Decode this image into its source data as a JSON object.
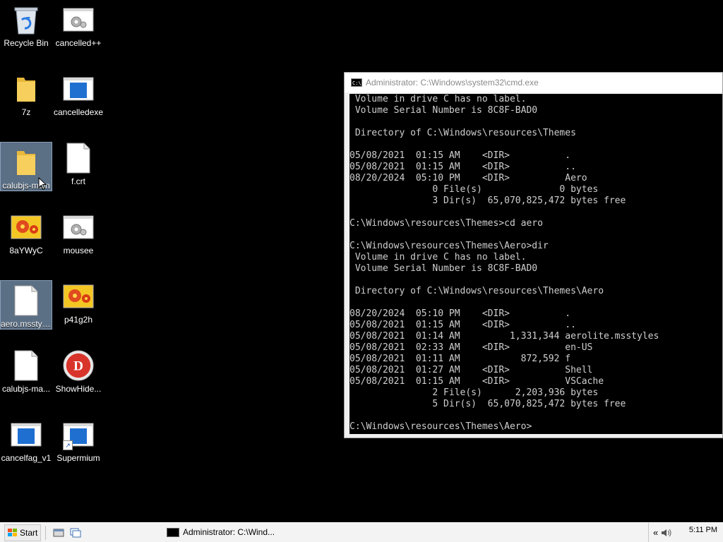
{
  "desktop": {
    "icons": [
      {
        "label": "Recycle Bin",
        "icon": "recycle-bin-icon"
      },
      {
        "label": "cancelled++",
        "icon": "application-gear-icon"
      },
      {
        "label": "7z",
        "icon": "folder-icon"
      },
      {
        "label": "cancelledexe",
        "icon": "application-window-icon"
      },
      {
        "label": "calubjs-main",
        "icon": "folder-icon"
      },
      {
        "label": "f.crt",
        "icon": "blank-file-icon"
      },
      {
        "label": "8aYWyC",
        "icon": "flower-image-icon"
      },
      {
        "label": "mousee",
        "icon": "application-gear-icon"
      },
      {
        "label": "aero.msstyles",
        "icon": "blank-file-icon"
      },
      {
        "label": "p41g2h",
        "icon": "flower-image-icon"
      },
      {
        "label": "calubjs-ma...",
        "icon": "blank-file-icon"
      },
      {
        "label": "ShowHide...",
        "icon": "red-d-circle-icon"
      },
      {
        "label": "cancelfag_v1",
        "icon": "application-window-icon"
      },
      {
        "label": "Supermium",
        "icon": "application-window-shortcut-icon"
      }
    ]
  },
  "cmd_window": {
    "title": "Administrator: C:\\Windows\\system32\\cmd.exe",
    "lines": [
      " Volume in drive C has no label.",
      " Volume Serial Number is 8C8F-BAD0",
      "",
      " Directory of C:\\Windows\\resources\\Themes",
      "",
      "05/08/2021  01:15 AM    <DIR>          .",
      "05/08/2021  01:15 AM    <DIR>          ..",
      "08/20/2024  05:10 PM    <DIR>          Aero",
      "               0 File(s)              0 bytes",
      "               3 Dir(s)  65,070,825,472 bytes free",
      "",
      "C:\\Windows\\resources\\Themes>cd aero",
      "",
      "C:\\Windows\\resources\\Themes\\Aero>dir",
      " Volume in drive C has no label.",
      " Volume Serial Number is 8C8F-BAD0",
      "",
      " Directory of C:\\Windows\\resources\\Themes\\Aero",
      "",
      "08/20/2024  05:10 PM    <DIR>          .",
      "05/08/2021  01:15 AM    <DIR>          ..",
      "05/08/2021  01:14 AM         1,331,344 aerolite.msstyles",
      "05/08/2021  02:33 AM    <DIR>          en-US",
      "05/08/2021  01:11 AM           872,592 f",
      "05/08/2021  01:27 AM    <DIR>          Shell",
      "05/08/2021  01:15 AM    <DIR>          VSCache",
      "               2 File(s)      2,203,936 bytes",
      "               5 Dir(s)  65,070,825,472 bytes free",
      "",
      "C:\\Windows\\resources\\Themes\\Aero>"
    ]
  },
  "taskbar": {
    "start_label": "Start",
    "task_label": "Administrator: C:\\Wind...",
    "clock": "5:11 PM",
    "tray_expand": "«"
  }
}
